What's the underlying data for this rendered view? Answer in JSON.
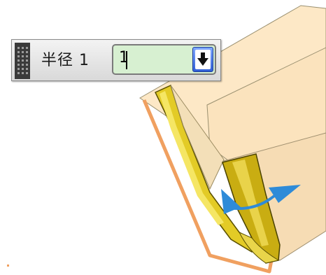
{
  "dynamic_input": {
    "label": "半径 1",
    "value": "1",
    "grip_icon": "grip-handle-icon",
    "dropdown_icon": "arrow-down-icon"
  },
  "viewport": {
    "colors": {
      "body": "#fbe6c2",
      "fillet": "#e0c81c",
      "edge_highlight": "#f0a060",
      "manipulator": "#2e8bd8"
    }
  }
}
